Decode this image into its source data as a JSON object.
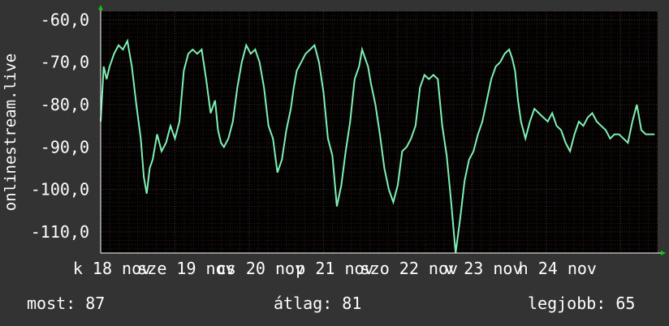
{
  "chart_data": {
    "type": "line",
    "ylabel": "onlinestream.live",
    "yticks": [
      "-60,0",
      "-70,0",
      "-80,0",
      "-90,0",
      "-100,0",
      "-110,0"
    ],
    "ytick_values": [
      -60,
      -70,
      -80,
      -90,
      -100,
      -110
    ],
    "ylim": [
      -115,
      -58
    ],
    "xlim": [
      0,
      7.5
    ],
    "xticks": [
      "k 18 nov",
      "sze 19 nov",
      "cs 20 nov",
      "p 21 nov",
      "szo 22 nov",
      "v 23 nov",
      "h 24 nov"
    ],
    "xtick_values": [
      0,
      1,
      2,
      3,
      4,
      5,
      6
    ],
    "grid": true,
    "series": [
      {
        "color": "#7ff0b4",
        "x": [
          0.0,
          0.04,
          0.08,
          0.12,
          0.18,
          0.24,
          0.3,
          0.36,
          0.42,
          0.48,
          0.54,
          0.58,
          0.62,
          0.66,
          0.7,
          0.76,
          0.82,
          0.88,
          0.94,
          1.0,
          1.06,
          1.12,
          1.18,
          1.24,
          1.3,
          1.36,
          1.42,
          1.48,
          1.54,
          1.58,
          1.62,
          1.66,
          1.72,
          1.78,
          1.84,
          1.9,
          1.96,
          2.02,
          2.08,
          2.14,
          2.2,
          2.26,
          2.32,
          2.38,
          2.44,
          2.5,
          2.56,
          2.6,
          2.64,
          2.7,
          2.76,
          2.82,
          2.88,
          2.94,
          3.0,
          3.06,
          3.12,
          3.18,
          3.24,
          3.3,
          3.36,
          3.42,
          3.48,
          3.52,
          3.56,
          3.6,
          3.64,
          3.7,
          3.76,
          3.82,
          3.88,
          3.94,
          4.0,
          4.06,
          4.12,
          4.18,
          4.24,
          4.3,
          4.36,
          4.42,
          4.48,
          4.54,
          4.6,
          4.66,
          4.72,
          4.78,
          4.84,
          4.9,
          4.96,
          5.02,
          5.08,
          5.14,
          5.2,
          5.26,
          5.32,
          5.38,
          5.44,
          5.5,
          5.54,
          5.58,
          5.62,
          5.66,
          5.72,
          5.78,
          5.84,
          5.9,
          5.96,
          6.02,
          6.08,
          6.14,
          6.2,
          6.26,
          6.32,
          6.38,
          6.44,
          6.5,
          6.56,
          6.62,
          6.68,
          6.74,
          6.8,
          6.86,
          6.92,
          6.98,
          7.04,
          7.1,
          7.16,
          7.22,
          7.28,
          7.34,
          7.4,
          7.46
        ],
        "values": [
          -84,
          -71,
          -74,
          -71,
          -68,
          -66,
          -67,
          -65,
          -71,
          -80,
          -88,
          -97,
          -101,
          -95,
          -93,
          -87,
          -91,
          -89,
          -85,
          -88,
          -84,
          -72,
          -68,
          -67,
          -68,
          -67,
          -74,
          -82,
          -79,
          -86,
          -89,
          -90,
          -88,
          -84,
          -76,
          -70,
          -66,
          -68,
          -67,
          -70,
          -76,
          -85,
          -88,
          -96,
          -93,
          -86,
          -81,
          -76,
          -72,
          -70,
          -68,
          -67,
          -66,
          -70,
          -77,
          -88,
          -92,
          -104,
          -99,
          -91,
          -84,
          -74,
          -71,
          -67,
          -69,
          -71,
          -75,
          -80,
          -87,
          -95,
          -100,
          -103,
          -99,
          -91,
          -90,
          -88,
          -85,
          -76,
          -73,
          -74,
          -73,
          -74,
          -85,
          -92,
          -103,
          -115,
          -107,
          -98,
          -93,
          -91,
          -87,
          -84,
          -79,
          -74,
          -71,
          -70,
          -68,
          -67,
          -69,
          -72,
          -79,
          -84,
          -88,
          -84,
          -81,
          -82,
          -83,
          -84,
          -82,
          -85,
          -86,
          -89,
          -91,
          -87,
          -84,
          -85,
          -83,
          -82,
          -84,
          -85,
          -86,
          -88,
          -87,
          -87,
          -88,
          -89,
          -84,
          -80,
          -86,
          -87,
          -87,
          -87
        ]
      }
    ]
  },
  "stats": {
    "now": "most: 87",
    "avg": "átlag: 81",
    "best": "legjobb: 65"
  },
  "colors": {
    "background": "#333333",
    "plot_background": "#000000",
    "line": "#7ff0b4",
    "grid": "#5a2a2a",
    "axis": "#ffffff",
    "arrow": "#00cc00"
  }
}
